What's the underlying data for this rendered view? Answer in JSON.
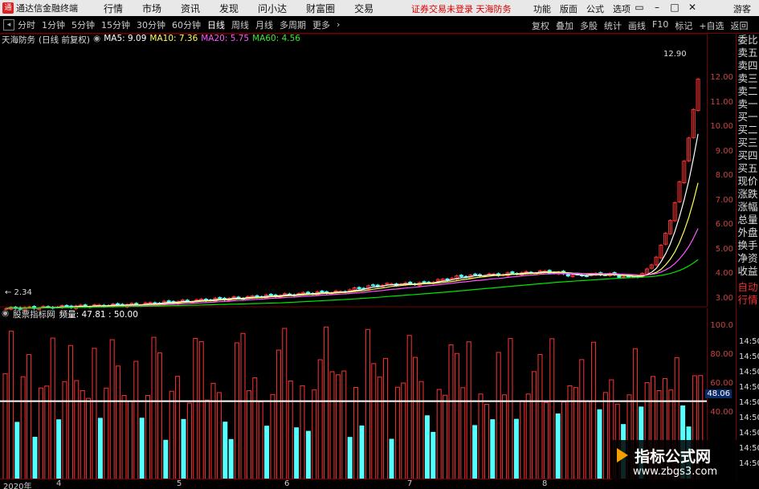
{
  "titlebar": {
    "app_title": "通达信金融终端",
    "menu": [
      "行情",
      "市场",
      "资讯",
      "发现",
      "问小达",
      "财富圈",
      "交易"
    ],
    "warning": "证券交易未登录 天海防务",
    "right_menu": [
      "功能",
      "版面",
      "公式",
      "选项"
    ],
    "guest": "游客"
  },
  "toolbar": {
    "periods": [
      "分时",
      "1分钟",
      "5分钟",
      "15分钟",
      "30分钟",
      "60分钟",
      "日线",
      "周线",
      "月线",
      "多周期",
      "更多"
    ],
    "active_period": "日线",
    "right_buttons": [
      "复权",
      "叠加",
      "多股",
      "统计",
      "画线",
      "F10",
      "标记",
      "+自选",
      "返回"
    ]
  },
  "chart_header": {
    "stock": "天海防务",
    "mode": "(日线 前复权)",
    "ma5": "MA5: 9.09",
    "ma10": "MA10: 7.36",
    "ma20": "MA20: 5.75",
    "ma60": "MA60: 4.56"
  },
  "price_axis": [
    "12.00",
    "11.00",
    "10.00",
    "9.00",
    "8.00",
    "7.00",
    "6.00",
    "5.00",
    "4.00",
    "3.00"
  ],
  "price_high_label": "12.90",
  "price_low_label": "2.34",
  "side_panel": [
    "委比",
    "卖五",
    "卖四",
    "卖三",
    "卖二",
    "卖一",
    "买一",
    "买二",
    "买三",
    "买四",
    "买五",
    "现价",
    "涨跌",
    "涨幅",
    "总量",
    "外盘",
    "换手",
    "净资",
    "收益",
    "自动",
    "行情"
  ],
  "vol_header": {
    "name": "股票指标网",
    "value": "频量: 47.81 : 50.00"
  },
  "vol_axis": [
    "100.0",
    "80.00",
    "60.00",
    "40.00"
  ],
  "vol_current": "48.06",
  "time_labels": [
    "14:50",
    "14:50",
    "14:50",
    "14:50",
    "14:50",
    "14:50",
    "14:50",
    "14:50",
    "14:50"
  ],
  "xaxis": [
    "2020年",
    "4",
    "5",
    "6",
    "7",
    "8"
  ],
  "watermark": {
    "title": "指标公式网",
    "url": "www.zbgs3.com"
  },
  "colors": {
    "up": "#ff3232",
    "down": "#54ffff",
    "ma5": "#ffffff",
    "ma10": "#ffff54",
    "ma20": "#ff54ff",
    "ma60": "#00e600",
    "level_line": "#ffffff"
  }
}
